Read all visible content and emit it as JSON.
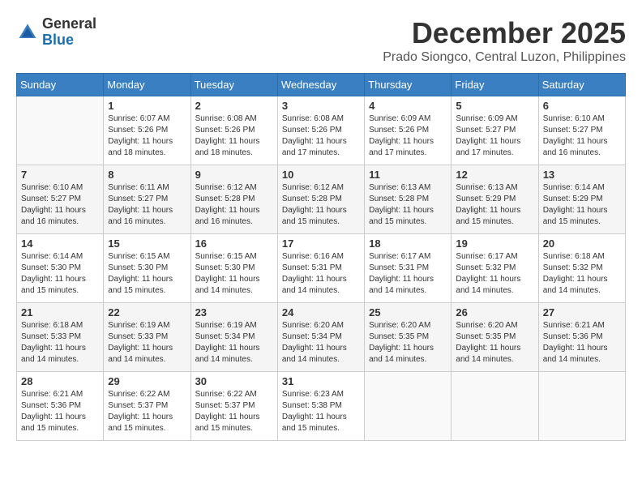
{
  "logo": {
    "text_general": "General",
    "text_blue": "Blue"
  },
  "title": {
    "month": "December 2025",
    "location": "Prado Siongco, Central Luzon, Philippines"
  },
  "weekdays": [
    "Sunday",
    "Monday",
    "Tuesday",
    "Wednesday",
    "Thursday",
    "Friday",
    "Saturday"
  ],
  "weeks": [
    [
      {
        "day": "",
        "sunrise": "",
        "sunset": "",
        "daylight": ""
      },
      {
        "day": "1",
        "sunrise": "Sunrise: 6:07 AM",
        "sunset": "Sunset: 5:26 PM",
        "daylight": "Daylight: 11 hours and 18 minutes."
      },
      {
        "day": "2",
        "sunrise": "Sunrise: 6:08 AM",
        "sunset": "Sunset: 5:26 PM",
        "daylight": "Daylight: 11 hours and 18 minutes."
      },
      {
        "day": "3",
        "sunrise": "Sunrise: 6:08 AM",
        "sunset": "Sunset: 5:26 PM",
        "daylight": "Daylight: 11 hours and 17 minutes."
      },
      {
        "day": "4",
        "sunrise": "Sunrise: 6:09 AM",
        "sunset": "Sunset: 5:26 PM",
        "daylight": "Daylight: 11 hours and 17 minutes."
      },
      {
        "day": "5",
        "sunrise": "Sunrise: 6:09 AM",
        "sunset": "Sunset: 5:27 PM",
        "daylight": "Daylight: 11 hours and 17 minutes."
      },
      {
        "day": "6",
        "sunrise": "Sunrise: 6:10 AM",
        "sunset": "Sunset: 5:27 PM",
        "daylight": "Daylight: 11 hours and 16 minutes."
      }
    ],
    [
      {
        "day": "7",
        "sunrise": "Sunrise: 6:10 AM",
        "sunset": "Sunset: 5:27 PM",
        "daylight": "Daylight: 11 hours and 16 minutes."
      },
      {
        "day": "8",
        "sunrise": "Sunrise: 6:11 AM",
        "sunset": "Sunset: 5:27 PM",
        "daylight": "Daylight: 11 hours and 16 minutes."
      },
      {
        "day": "9",
        "sunrise": "Sunrise: 6:12 AM",
        "sunset": "Sunset: 5:28 PM",
        "daylight": "Daylight: 11 hours and 16 minutes."
      },
      {
        "day": "10",
        "sunrise": "Sunrise: 6:12 AM",
        "sunset": "Sunset: 5:28 PM",
        "daylight": "Daylight: 11 hours and 15 minutes."
      },
      {
        "day": "11",
        "sunrise": "Sunrise: 6:13 AM",
        "sunset": "Sunset: 5:28 PM",
        "daylight": "Daylight: 11 hours and 15 minutes."
      },
      {
        "day": "12",
        "sunrise": "Sunrise: 6:13 AM",
        "sunset": "Sunset: 5:29 PM",
        "daylight": "Daylight: 11 hours and 15 minutes."
      },
      {
        "day": "13",
        "sunrise": "Sunrise: 6:14 AM",
        "sunset": "Sunset: 5:29 PM",
        "daylight": "Daylight: 11 hours and 15 minutes."
      }
    ],
    [
      {
        "day": "14",
        "sunrise": "Sunrise: 6:14 AM",
        "sunset": "Sunset: 5:30 PM",
        "daylight": "Daylight: 11 hours and 15 minutes."
      },
      {
        "day": "15",
        "sunrise": "Sunrise: 6:15 AM",
        "sunset": "Sunset: 5:30 PM",
        "daylight": "Daylight: 11 hours and 15 minutes."
      },
      {
        "day": "16",
        "sunrise": "Sunrise: 6:15 AM",
        "sunset": "Sunset: 5:30 PM",
        "daylight": "Daylight: 11 hours and 14 minutes."
      },
      {
        "day": "17",
        "sunrise": "Sunrise: 6:16 AM",
        "sunset": "Sunset: 5:31 PM",
        "daylight": "Daylight: 11 hours and 14 minutes."
      },
      {
        "day": "18",
        "sunrise": "Sunrise: 6:17 AM",
        "sunset": "Sunset: 5:31 PM",
        "daylight": "Daylight: 11 hours and 14 minutes."
      },
      {
        "day": "19",
        "sunrise": "Sunrise: 6:17 AM",
        "sunset": "Sunset: 5:32 PM",
        "daylight": "Daylight: 11 hours and 14 minutes."
      },
      {
        "day": "20",
        "sunrise": "Sunrise: 6:18 AM",
        "sunset": "Sunset: 5:32 PM",
        "daylight": "Daylight: 11 hours and 14 minutes."
      }
    ],
    [
      {
        "day": "21",
        "sunrise": "Sunrise: 6:18 AM",
        "sunset": "Sunset: 5:33 PM",
        "daylight": "Daylight: 11 hours and 14 minutes."
      },
      {
        "day": "22",
        "sunrise": "Sunrise: 6:19 AM",
        "sunset": "Sunset: 5:33 PM",
        "daylight": "Daylight: 11 hours and 14 minutes."
      },
      {
        "day": "23",
        "sunrise": "Sunrise: 6:19 AM",
        "sunset": "Sunset: 5:34 PM",
        "daylight": "Daylight: 11 hours and 14 minutes."
      },
      {
        "day": "24",
        "sunrise": "Sunrise: 6:20 AM",
        "sunset": "Sunset: 5:34 PM",
        "daylight": "Daylight: 11 hours and 14 minutes."
      },
      {
        "day": "25",
        "sunrise": "Sunrise: 6:20 AM",
        "sunset": "Sunset: 5:35 PM",
        "daylight": "Daylight: 11 hours and 14 minutes."
      },
      {
        "day": "26",
        "sunrise": "Sunrise: 6:20 AM",
        "sunset": "Sunset: 5:35 PM",
        "daylight": "Daylight: 11 hours and 14 minutes."
      },
      {
        "day": "27",
        "sunrise": "Sunrise: 6:21 AM",
        "sunset": "Sunset: 5:36 PM",
        "daylight": "Daylight: 11 hours and 14 minutes."
      }
    ],
    [
      {
        "day": "28",
        "sunrise": "Sunrise: 6:21 AM",
        "sunset": "Sunset: 5:36 PM",
        "daylight": "Daylight: 11 hours and 15 minutes."
      },
      {
        "day": "29",
        "sunrise": "Sunrise: 6:22 AM",
        "sunset": "Sunset: 5:37 PM",
        "daylight": "Daylight: 11 hours and 15 minutes."
      },
      {
        "day": "30",
        "sunrise": "Sunrise: 6:22 AM",
        "sunset": "Sunset: 5:37 PM",
        "daylight": "Daylight: 11 hours and 15 minutes."
      },
      {
        "day": "31",
        "sunrise": "Sunrise: 6:23 AM",
        "sunset": "Sunset: 5:38 PM",
        "daylight": "Daylight: 11 hours and 15 minutes."
      },
      {
        "day": "",
        "sunrise": "",
        "sunset": "",
        "daylight": ""
      },
      {
        "day": "",
        "sunrise": "",
        "sunset": "",
        "daylight": ""
      },
      {
        "day": "",
        "sunrise": "",
        "sunset": "",
        "daylight": ""
      }
    ]
  ]
}
